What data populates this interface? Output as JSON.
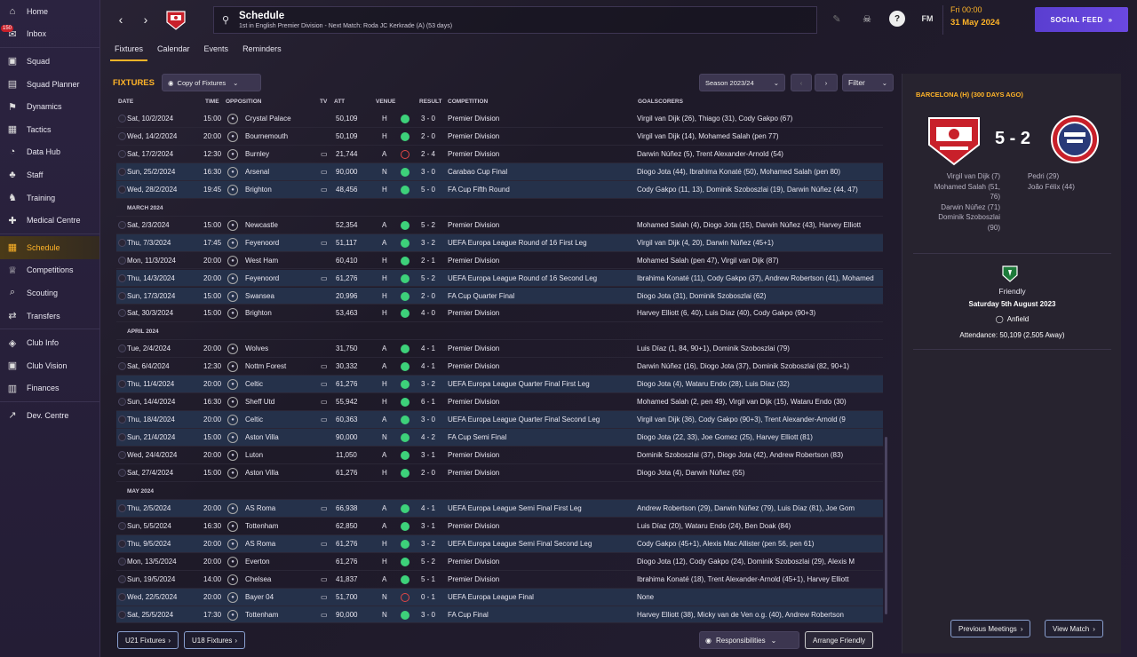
{
  "sidebar": {
    "items": [
      {
        "label": "Home",
        "icon": "home-icon"
      },
      {
        "label": "Inbox",
        "icon": "inbox-icon",
        "badge": "150"
      },
      {
        "label": "Squad",
        "icon": "shirt-icon"
      },
      {
        "label": "Squad Planner",
        "icon": "clipboard-icon"
      },
      {
        "label": "Dynamics",
        "icon": "dynamics-icon"
      },
      {
        "label": "Tactics",
        "icon": "tactics-icon"
      },
      {
        "label": "Data Hub",
        "icon": "data-hub-icon"
      },
      {
        "label": "Staff",
        "icon": "staff-icon"
      },
      {
        "label": "Training",
        "icon": "training-icon"
      },
      {
        "label": "Medical Centre",
        "icon": "medical-icon"
      },
      {
        "label": "Schedule",
        "icon": "calendar-icon"
      },
      {
        "label": "Competitions",
        "icon": "trophy-icon"
      },
      {
        "label": "Scouting",
        "icon": "scouting-icon"
      },
      {
        "label": "Transfers",
        "icon": "transfers-icon"
      },
      {
        "label": "Club Info",
        "icon": "shield-icon"
      },
      {
        "label": "Club Vision",
        "icon": "vision-icon"
      },
      {
        "label": "Finances",
        "icon": "finances-icon"
      },
      {
        "label": "Dev. Centre",
        "icon": "dev-centre-icon"
      }
    ]
  },
  "header": {
    "title": "Schedule",
    "subtitle": "1st in English Premier Division - Next Match: Roda JC Kerkrade (A) (53 days)",
    "fm_label": "FM",
    "time": "Fri 00:00",
    "date": "31 May 2024",
    "social_feed": "SOCIAL FEED"
  },
  "tabs": [
    "Fixtures",
    "Calendar",
    "Events",
    "Reminders"
  ],
  "fixtures": {
    "title": "FIXTURES",
    "copy_button": "Copy of Fixtures",
    "season": "Season 2023/24",
    "filter": "Filter",
    "columns": {
      "date": "DATE",
      "time": "TIME",
      "opposition": "OPPOSITION",
      "tv": "TV",
      "att": "ATT",
      "venue": "VENUE",
      "result": "RESULT",
      "competition": "COMPETITION",
      "goalscorers": "GOALSCORERS"
    },
    "rows": [
      {
        "date": "Sat, 10/2/2024",
        "time": "15:00",
        "opp": "Crystal Palace",
        "tv": false,
        "att": "50,109",
        "venue": "H",
        "res": "w",
        "score": "3 - 0",
        "comp": "Premier Division",
        "scorers": "Virgil van Dijk (26), Thiago (31), Cody Gakpo (67)",
        "hl": false
      },
      {
        "date": "Wed, 14/2/2024",
        "time": "20:00",
        "opp": "Bournemouth",
        "tv": false,
        "att": "50,109",
        "venue": "H",
        "res": "w",
        "score": "2 - 0",
        "comp": "Premier Division",
        "scorers": "Virgil van Dijk (14), Mohamed Salah (pen 77)",
        "hl": false
      },
      {
        "date": "Sat, 17/2/2024",
        "time": "12:30",
        "opp": "Burnley",
        "tv": true,
        "att": "21,744",
        "venue": "A",
        "res": "l",
        "score": "2 - 4",
        "comp": "Premier Division",
        "scorers": "Darwin Núñez (5), Trent Alexander-Arnold (54)",
        "hl": false
      },
      {
        "date": "Sun, 25/2/2024",
        "time": "16:30",
        "opp": "Arsenal",
        "tv": true,
        "att": "90,000",
        "venue": "N",
        "res": "w",
        "score": "3 - 0",
        "comp": "Carabao Cup Final",
        "scorers": "Diogo Jota (44), Ibrahima Konaté (50), Mohamed Salah (pen 80)",
        "hl": true
      },
      {
        "date": "Wed, 28/2/2024",
        "time": "19:45",
        "opp": "Brighton",
        "tv": true,
        "att": "48,456",
        "venue": "H",
        "res": "w",
        "score": "5 - 0",
        "comp": "FA Cup Fifth Round",
        "scorers": "Cody Gakpo (11, 13), Dominik Szoboszlai (19), Darwin Núñez (44, 47)",
        "hl": true
      },
      {
        "month": "MARCH 2024"
      },
      {
        "date": "Sat, 2/3/2024",
        "time": "15:00",
        "opp": "Newcastle",
        "tv": false,
        "att": "52,354",
        "venue": "A",
        "res": "w",
        "score": "5 - 2",
        "comp": "Premier Division",
        "scorers": "Mohamed Salah (4), Diogo Jota (15), Darwin Núñez (43), Harvey Elliott",
        "hl": false
      },
      {
        "date": "Thu, 7/3/2024",
        "time": "17:45",
        "opp": "Feyenoord",
        "tv": true,
        "att": "51,117",
        "venue": "A",
        "res": "w",
        "score": "3 - 2",
        "comp": "UEFA Europa League Round of 16 First Leg",
        "scorers": "Virgil van Dijk (4, 20), Darwin Núñez (45+1)",
        "hl": true
      },
      {
        "date": "Mon, 11/3/2024",
        "time": "20:00",
        "opp": "West Ham",
        "tv": false,
        "att": "60,410",
        "venue": "H",
        "res": "w",
        "score": "2 - 1",
        "comp": "Premier Division",
        "scorers": "Mohamed Salah (pen 47), Virgil van Dijk (87)",
        "hl": false
      },
      {
        "date": "Thu, 14/3/2024",
        "time": "20:00",
        "opp": "Feyenoord",
        "tv": true,
        "att": "61,276",
        "venue": "H",
        "res": "w",
        "score": "5 - 2",
        "comp": "UEFA Europa League Round of 16 Second Leg",
        "scorers": "Ibrahima Konaté (11), Cody Gakpo (37), Andrew Robertson (41), Mohamed",
        "hl": true
      },
      {
        "date": "Sun, 17/3/2024",
        "time": "15:00",
        "opp": "Swansea",
        "tv": false,
        "att": "20,996",
        "venue": "H",
        "res": "w",
        "score": "2 - 0",
        "comp": "FA Cup Quarter Final",
        "scorers": "Diogo Jota (31), Dominik Szoboszlai (62)",
        "hl": true
      },
      {
        "date": "Sat, 30/3/2024",
        "time": "15:00",
        "opp": "Brighton",
        "tv": false,
        "att": "53,463",
        "venue": "H",
        "res": "w",
        "score": "4 - 0",
        "comp": "Premier Division",
        "scorers": "Harvey Elliott (6, 40), Luis Díaz (40), Cody Gakpo (90+3)",
        "hl": false
      },
      {
        "month": "APRIL 2024"
      },
      {
        "date": "Tue, 2/4/2024",
        "time": "20:00",
        "opp": "Wolves",
        "tv": false,
        "att": "31,750",
        "venue": "A",
        "res": "w",
        "score": "4 - 1",
        "comp": "Premier Division",
        "scorers": "Luis Díaz (1, 84, 90+1), Dominik Szoboszlai (79)",
        "hl": false
      },
      {
        "date": "Sat, 6/4/2024",
        "time": "12:30",
        "opp": "Nottm Forest",
        "tv": true,
        "att": "30,332",
        "venue": "A",
        "res": "w",
        "score": "4 - 1",
        "comp": "Premier Division",
        "scorers": "Darwin Núñez (16), Diogo Jota (37), Dominik Szoboszlai (82, 90+1)",
        "hl": false
      },
      {
        "date": "Thu, 11/4/2024",
        "time": "20:00",
        "opp": "Celtic",
        "tv": true,
        "att": "61,276",
        "venue": "H",
        "res": "w",
        "score": "3 - 2",
        "comp": "UEFA Europa League Quarter Final First Leg",
        "scorers": "Diogo Jota (4), Wataru Endo (28), Luis Díaz (32)",
        "hl": true
      },
      {
        "date": "Sun, 14/4/2024",
        "time": "16:30",
        "opp": "Sheff Utd",
        "tv": true,
        "att": "55,942",
        "venue": "H",
        "res": "w",
        "score": "6 - 1",
        "comp": "Premier Division",
        "scorers": "Mohamed Salah (2, pen 49), Virgil van Dijk (15), Wataru Endo (30)",
        "hl": false
      },
      {
        "date": "Thu, 18/4/2024",
        "time": "20:00",
        "opp": "Celtic",
        "tv": true,
        "att": "60,363",
        "venue": "A",
        "res": "w",
        "score": "3 - 0",
        "comp": "UEFA Europa League Quarter Final Second Leg",
        "scorers": "Virgil van Dijk (36), Cody Gakpo (90+3), Trent Alexander-Arnold (9",
        "hl": true
      },
      {
        "date": "Sun, 21/4/2024",
        "time": "15:00",
        "opp": "Aston Villa",
        "tv": false,
        "att": "90,000",
        "venue": "N",
        "res": "w",
        "score": "4 - 2",
        "comp": "FA Cup Semi Final",
        "scorers": "Diogo Jota (22, 33), Joe Gomez (25), Harvey Elliott (81)",
        "hl": true
      },
      {
        "date": "Wed, 24/4/2024",
        "time": "20:00",
        "opp": "Luton",
        "tv": false,
        "att": "11,050",
        "venue": "A",
        "res": "w",
        "score": "3 - 1",
        "comp": "Premier Division",
        "scorers": "Dominik Szoboszlai (37), Diogo Jota (42), Andrew Robertson (83)",
        "hl": false
      },
      {
        "date": "Sat, 27/4/2024",
        "time": "15:00",
        "opp": "Aston Villa",
        "tv": false,
        "att": "61,276",
        "venue": "H",
        "res": "w",
        "score": "2 - 0",
        "comp": "Premier Division",
        "scorers": "Diogo Jota (4), Darwin Núñez (55)",
        "hl": false
      },
      {
        "month": "MAY 2024"
      },
      {
        "date": "Thu, 2/5/2024",
        "time": "20:00",
        "opp": "AS Roma",
        "tv": true,
        "att": "66,938",
        "venue": "A",
        "res": "w",
        "score": "4 - 1",
        "comp": "UEFA Europa League Semi Final First Leg",
        "scorers": "Andrew Robertson (29), Darwin Núñez (79), Luis Díaz (81), Joe Gom",
        "hl": true
      },
      {
        "date": "Sun, 5/5/2024",
        "time": "16:30",
        "opp": "Tottenham",
        "tv": false,
        "att": "62,850",
        "venue": "A",
        "res": "w",
        "score": "3 - 1",
        "comp": "Premier Division",
        "scorers": "Luis Díaz (20), Wataru Endo (24), Ben Doak (84)",
        "hl": false
      },
      {
        "date": "Thu, 9/5/2024",
        "time": "20:00",
        "opp": "AS Roma",
        "tv": true,
        "att": "61,276",
        "venue": "H",
        "res": "w",
        "score": "3 - 2",
        "comp": "UEFA Europa League Semi Final Second Leg",
        "scorers": "Cody Gakpo (45+1), Alexis Mac Allister (pen 56, pen 61)",
        "hl": true
      },
      {
        "date": "Mon, 13/5/2024",
        "time": "20:00",
        "opp": "Everton",
        "tv": false,
        "att": "61,276",
        "venue": "H",
        "res": "w",
        "score": "5 - 2",
        "comp": "Premier Division",
        "scorers": "Diogo Jota (12), Cody Gakpo (24), Dominik Szoboszlai (29), Alexis M",
        "hl": false
      },
      {
        "date": "Sun, 19/5/2024",
        "time": "14:00",
        "opp": "Chelsea",
        "tv": true,
        "att": "41,837",
        "venue": "A",
        "res": "w",
        "score": "5 - 1",
        "comp": "Premier Division",
        "scorers": "Ibrahima Konaté (18), Trent Alexander-Arnold (45+1), Harvey Elliott",
        "hl": false
      },
      {
        "date": "Wed, 22/5/2024",
        "time": "20:00",
        "opp": "Bayer 04",
        "tv": true,
        "att": "51,700",
        "venue": "N",
        "res": "l",
        "score": "0 - 1",
        "comp": "UEFA Europa League Final",
        "scorers": "None",
        "hl": true
      },
      {
        "date": "Sat, 25/5/2024",
        "time": "17:30",
        "opp": "Tottenham",
        "tv": true,
        "att": "90,000",
        "venue": "N",
        "res": "w",
        "score": "3 - 0",
        "comp": "FA Cup Final",
        "scorers": "Harvey Elliott (38), Micky van de Ven o.g. (40), Andrew Robertson",
        "hl": true
      }
    ],
    "u21": "U21 Fixtures",
    "u18": "U18 Fixtures",
    "responsibilities": "Responsibilities",
    "arrange": "Arrange Friendly"
  },
  "match": {
    "title": "BARCELONA (H) (300 DAYS AGO)",
    "score": "5 - 2",
    "home_scorers": [
      "Virgil van Dijk (7)",
      "Mohamed Salah (51,",
      "76)",
      "Darwin Núñez (71)",
      "Dominik Szoboszlai",
      "(90)"
    ],
    "away_scorers": [
      "Pedri (29)",
      "João Félix (44)"
    ],
    "type": "Friendly",
    "date": "Saturday 5th August 2023",
    "venue": "Anfield",
    "attendance": "Attendance: 50,109 (2,505 Away)",
    "prev_meetings": "Previous Meetings",
    "view_match": "View Match"
  },
  "colors": {
    "accent": "#ffb428",
    "win": "#3dd17a",
    "loss": "#e04646",
    "social": "#6a48e0"
  }
}
